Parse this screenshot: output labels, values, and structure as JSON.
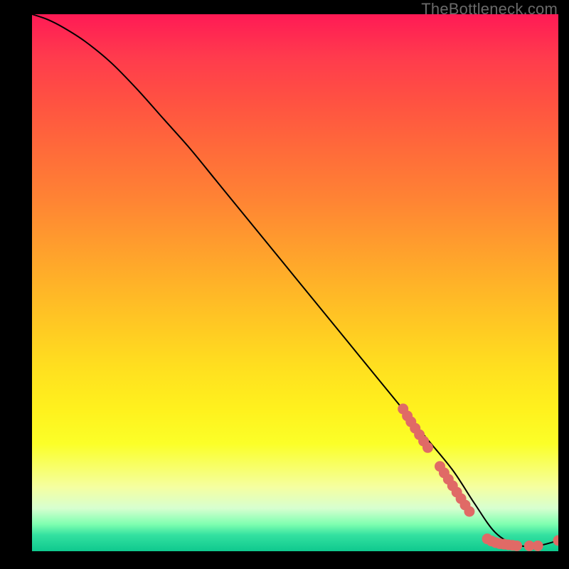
{
  "watermark": "TheBottleneck.com",
  "chart_data": {
    "type": "line",
    "title": "",
    "xlabel": "",
    "ylabel": "",
    "xlim": [
      0,
      100
    ],
    "ylim": [
      0,
      100
    ],
    "curve": {
      "name": "bottleneck-curve",
      "x": [
        0,
        3,
        6,
        10,
        15,
        20,
        25,
        30,
        35,
        40,
        45,
        50,
        55,
        60,
        65,
        70,
        75,
        80,
        84,
        88,
        92,
        96,
        100
      ],
      "y": [
        100,
        99,
        97.5,
        95,
        91,
        86,
        80.5,
        75,
        69,
        63,
        57,
        51,
        45,
        39,
        33,
        27,
        21,
        15,
        9,
        3.5,
        1.2,
        1.0,
        2.0
      ]
    },
    "dots": {
      "name": "data-points",
      "color": "#e06a66",
      "points": [
        {
          "x": 70.5,
          "y": 26.5
        },
        {
          "x": 71.3,
          "y": 25.2
        },
        {
          "x": 72.0,
          "y": 24.1
        },
        {
          "x": 72.8,
          "y": 22.9
        },
        {
          "x": 73.6,
          "y": 21.7
        },
        {
          "x": 74.4,
          "y": 20.5
        },
        {
          "x": 75.2,
          "y": 19.3
        },
        {
          "x": 77.5,
          "y": 15.8
        },
        {
          "x": 78.3,
          "y": 14.6
        },
        {
          "x": 79.1,
          "y": 13.4
        },
        {
          "x": 79.9,
          "y": 12.2
        },
        {
          "x": 80.7,
          "y": 11.0
        },
        {
          "x": 81.5,
          "y": 9.8
        },
        {
          "x": 82.3,
          "y": 8.6
        },
        {
          "x": 83.1,
          "y": 7.4
        },
        {
          "x": 86.5,
          "y": 2.3
        },
        {
          "x": 87.3,
          "y": 1.9
        },
        {
          "x": 88.1,
          "y": 1.6
        },
        {
          "x": 88.9,
          "y": 1.4
        },
        {
          "x": 89.7,
          "y": 1.3
        },
        {
          "x": 90.5,
          "y": 1.2
        },
        {
          "x": 91.3,
          "y": 1.1
        },
        {
          "x": 92.1,
          "y": 1.0
        },
        {
          "x": 94.5,
          "y": 1.0
        },
        {
          "x": 96.1,
          "y": 1.0
        },
        {
          "x": 100.0,
          "y": 2.0
        }
      ]
    }
  }
}
